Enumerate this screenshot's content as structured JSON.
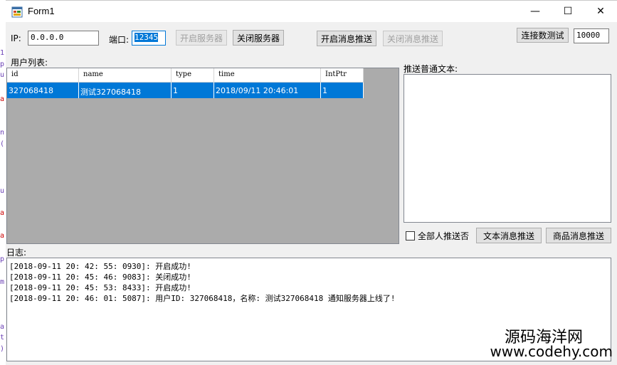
{
  "window": {
    "title": "Form1",
    "minimize": "—",
    "maximize": "☐",
    "close": "✕"
  },
  "controls": {
    "ip_label": "IP:",
    "ip_value": "0.0.0.0",
    "port_label": "端口:",
    "port_value": "12345",
    "start_server": "开启服务器",
    "stop_server": "关闭服务器",
    "start_push": "开启消息推送",
    "stop_push": "关闭消息推送",
    "conn_test": "连接数测试",
    "conn_count": "10000"
  },
  "users": {
    "label": "用户列表:",
    "columns": [
      "id",
      "name",
      "type",
      "time",
      "IntPtr"
    ],
    "rows": [
      [
        "327068418",
        "测试327068418",
        "1",
        "2018/09/11 20:46:01",
        "1"
      ]
    ]
  },
  "push": {
    "label": "推送普通文本:",
    "text": "",
    "all_label": "全部人推送否",
    "text_push": "文本消息推送",
    "goods_push": "商品消息推送"
  },
  "log": {
    "label": "日志:",
    "lines": [
      "[2018-09-11 20: 42: 55: 0930]: 开启成功!",
      "[2018-09-11 20: 45: 46: 9083]: 关闭成功!",
      "[2018-09-11 20: 45: 53: 8433]: 开启成功!",
      "[2018-09-11 20: 46: 01: 5087]: 用户ID: 327068418，名称: 测试327068418 通知服务器上线了!"
    ]
  },
  "watermark": {
    "cn": "源码海洋网",
    "url": "www.codehy.com"
  },
  "side_code": [
    "1",
    "p",
    "u",
    "a",
    "n",
    "(",
    "u",
    "a",
    "a",
    "p",
    "m",
    "a",
    "t",
    ")"
  ]
}
